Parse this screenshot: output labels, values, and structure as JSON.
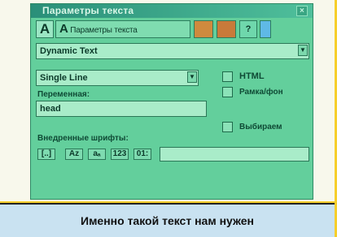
{
  "window": {
    "title": "Параметры текста",
    "close": "×"
  },
  "toolbar": {
    "a_label": "A",
    "params_aa": "A",
    "params_label": "Параметры текста",
    "help": "?"
  },
  "text_type": {
    "value": "Dynamic Text",
    "arrow": "▼"
  },
  "line_type": {
    "value": "Single Line",
    "arrow": "▼"
  },
  "options": {
    "html": "HTML",
    "border": "Рамка/фон",
    "selectable": "Выбираем"
  },
  "variable": {
    "label": "Переменная:",
    "value": "head"
  },
  "fonts": {
    "label": "Внедренные шрифты:",
    "buttons": [
      "[..]",
      "Az",
      "aₐ",
      "123",
      "01:"
    ],
    "input": ""
  },
  "caption": {
    "text": "Именно такой текст нам нужен"
  },
  "colors": {
    "frame": "#f6ce2a",
    "panel": "#63cf9c",
    "caption_bg": "#c9e2f1"
  }
}
